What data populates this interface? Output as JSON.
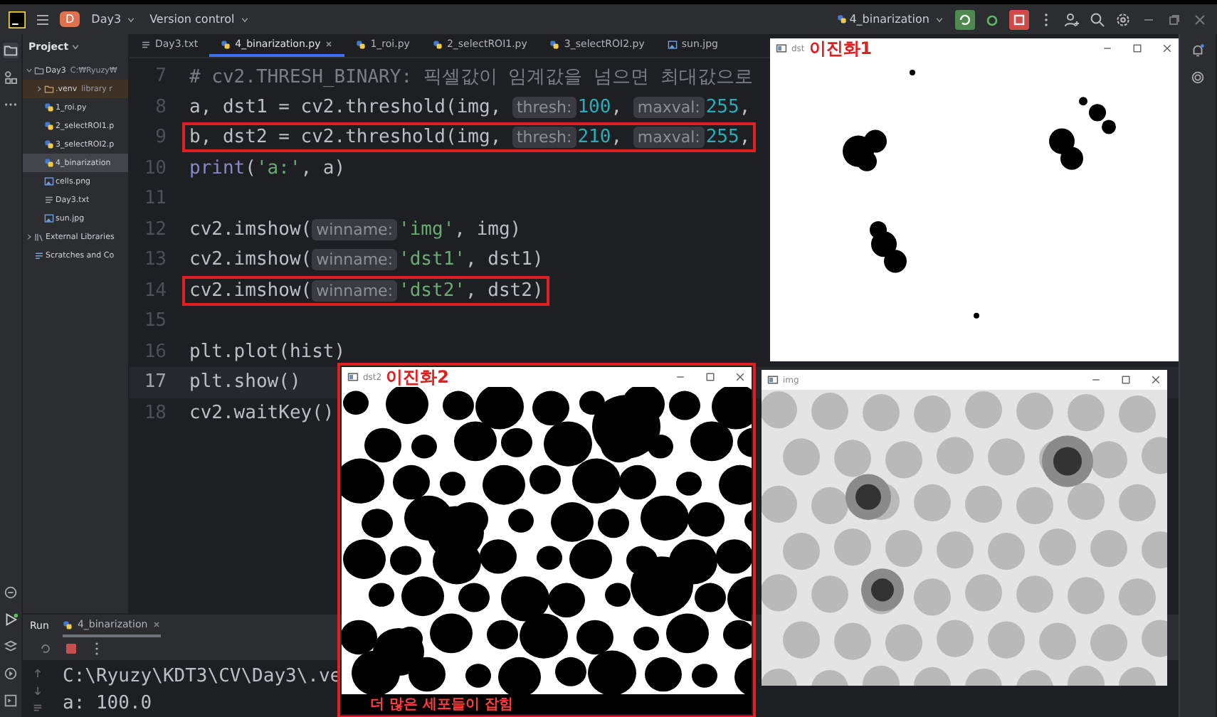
{
  "title_bar": {
    "project_badge": "D",
    "project": "Day3",
    "vcs": "Version control",
    "run_config": "4_binarization"
  },
  "project_panel": {
    "title": "Project",
    "tree": [
      {
        "label": "Day3",
        "detail": "C:₩Ryuzy₩",
        "kind": "folder",
        "expanded": true,
        "selected": false,
        "children": [
          {
            "label": ".venv",
            "detail": "library r",
            "kind": "excluded-folder",
            "expanded": false,
            "selected": false
          },
          {
            "label": "1_roi.py",
            "kind": "python",
            "selected": false
          },
          {
            "label": "2_selectROI1.p",
            "kind": "python",
            "selected": false
          },
          {
            "label": "3_selectROI2.p",
            "kind": "python",
            "selected": false
          },
          {
            "label": "4_binarization",
            "kind": "python",
            "selected": true
          },
          {
            "label": "cells.png",
            "kind": "image",
            "selected": false
          },
          {
            "label": "Day3.txt",
            "kind": "text",
            "selected": false
          },
          {
            "label": "sun.jpg",
            "kind": "image",
            "selected": false
          }
        ]
      },
      {
        "label": "External Libraries",
        "kind": "library",
        "expanded": false,
        "selected": false
      },
      {
        "label": "Scratches and Co",
        "kind": "scratch",
        "selected": false
      }
    ]
  },
  "editor": {
    "tabs": [
      {
        "label": "Day3.txt",
        "kind": "text",
        "selected": false
      },
      {
        "label": "4_binarization.py",
        "kind": "python",
        "selected": true
      },
      {
        "label": "1_roi.py",
        "kind": "python",
        "selected": false
      },
      {
        "label": "2_selectROI1.py",
        "kind": "python",
        "selected": false
      },
      {
        "label": "3_selectROI2.py",
        "kind": "python",
        "selected": false
      },
      {
        "label": "sun.jpg",
        "kind": "image",
        "selected": false
      }
    ],
    "lines": [
      {
        "number": "7",
        "current": false,
        "boxed": false,
        "segments": [
          {
            "kind": "comment",
            "text": "# cv2.THRESH_BINARY: 픽셀값이 임계값을 넘으면 최대값으로"
          }
        ]
      },
      {
        "number": "8",
        "current": false,
        "boxed": false,
        "segments": [
          {
            "kind": "plain",
            "text": "a, dst1 = cv2.threshold(img, "
          },
          {
            "kind": "hint",
            "text": "thresh:"
          },
          {
            "kind": "number",
            "text": "100"
          },
          {
            "kind": "plain",
            "text": ", "
          },
          {
            "kind": "hint",
            "text": "maxval:"
          },
          {
            "kind": "number",
            "text": "255"
          },
          {
            "kind": "plain",
            "text": ","
          }
        ]
      },
      {
        "number": "9",
        "current": false,
        "boxed": true,
        "segments": [
          {
            "kind": "plain",
            "text": "b, dst2 = cv2.threshold(img, "
          },
          {
            "kind": "hint",
            "text": "thresh:"
          },
          {
            "kind": "number",
            "text": "210"
          },
          {
            "kind": "plain",
            "text": ", "
          },
          {
            "kind": "hint",
            "text": "maxval:"
          },
          {
            "kind": "number",
            "text": "255"
          },
          {
            "kind": "plain",
            "text": ","
          }
        ]
      },
      {
        "number": "10",
        "current": false,
        "boxed": false,
        "segments": [
          {
            "kind": "builtin",
            "text": "print"
          },
          {
            "kind": "plain",
            "text": "("
          },
          {
            "kind": "string",
            "text": "'a:'"
          },
          {
            "kind": "plain",
            "text": ", a)"
          }
        ]
      },
      {
        "number": "11",
        "current": false
      },
      {
        "number": "12",
        "current": false,
        "boxed": false,
        "segments": [
          {
            "kind": "plain",
            "text": "cv2.imshow("
          },
          {
            "kind": "hint",
            "text": "winname:"
          },
          {
            "kind": "string",
            "text": "'img'"
          },
          {
            "kind": "plain",
            "text": ", img)"
          }
        ]
      },
      {
        "number": "13",
        "current": false,
        "boxed": false,
        "segments": [
          {
            "kind": "plain",
            "text": "cv2.imshow("
          },
          {
            "kind": "hint",
            "text": "winname:"
          },
          {
            "kind": "string",
            "text": "'dst1'"
          },
          {
            "kind": "plain",
            "text": ", dst1)"
          }
        ]
      },
      {
        "number": "14",
        "current": false,
        "boxed": true,
        "segments": [
          {
            "kind": "plain",
            "text": "cv2.imshow("
          },
          {
            "kind": "hint",
            "text": "winname:"
          },
          {
            "kind": "string",
            "text": "'dst2'"
          },
          {
            "kind": "plain",
            "text": ", dst2)"
          }
        ]
      },
      {
        "number": "15",
        "current": false
      },
      {
        "number": "16",
        "current": false,
        "boxed": false,
        "segments": [
          {
            "kind": "plain",
            "text": "plt.plot(hist)"
          }
        ]
      },
      {
        "number": "17",
        "current": true,
        "boxed": false,
        "segments": [
          {
            "kind": "plain",
            "text": "plt.show()"
          }
        ]
      },
      {
        "number": "18",
        "current": false,
        "boxed": false,
        "segments": [
          {
            "kind": "plain",
            "text": "cv2.waitKey()"
          }
        ]
      }
    ]
  },
  "run_panel": {
    "title": "Run",
    "tab": "4_binarization",
    "console": [
      "C:\\Ryuzy\\KDT3\\CV\\Day3\\.ve",
      "a: 100.0"
    ]
  },
  "windows": [
    {
      "title": "dst",
      "annotation": "이진화1",
      "kind": "binary-sparse",
      "boxed": false
    },
    {
      "title": "dst2",
      "annotation": "이진화2",
      "kind": "binary-dense",
      "boxed": true,
      "note": "더 많은 세포들이 잡힘"
    },
    {
      "title": "img",
      "kind": "photo",
      "boxed": false
    }
  ]
}
